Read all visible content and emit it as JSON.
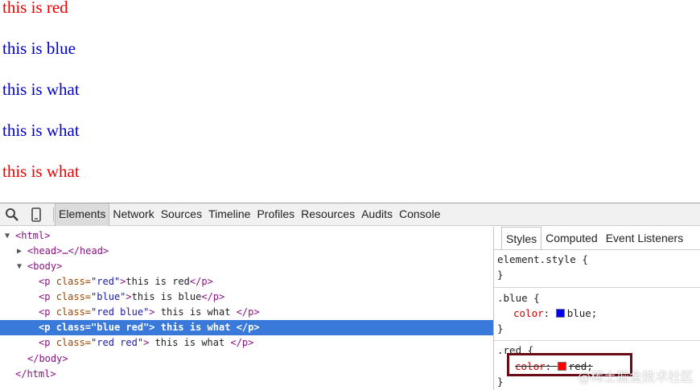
{
  "page": {
    "lines": [
      {
        "text": "this is red",
        "color": "#ee0000"
      },
      {
        "text": "this is blue",
        "color": "#0000cc"
      },
      {
        "text": "this is what",
        "color": "#0000cc"
      },
      {
        "text": "this is what",
        "color": "#0000cc"
      },
      {
        "text": "this is what",
        "color": "#ee0000"
      }
    ]
  },
  "toolbar": {
    "tabs": [
      "Elements",
      "Network",
      "Sources",
      "Timeline",
      "Profiles",
      "Resources",
      "Audits",
      "Console"
    ],
    "active_tab": "Elements",
    "icons": [
      "search-icon",
      "device-mode-icon"
    ]
  },
  "dom": {
    "html_open": "<html>",
    "head": "<head>…</head>",
    "body_open": "<body>",
    "p1": {
      "tag_open": "<p ",
      "attr": "class=",
      "val": "\"red\"",
      "close": ">",
      "text": "this is red",
      "end": "</p>"
    },
    "p2": {
      "tag_open": "<p ",
      "attr": "class=",
      "val": "\"blue\"",
      "close": ">",
      "text": "this is blue",
      "end": "</p>"
    },
    "p3": {
      "tag_open": "<p ",
      "attr": "class=",
      "val": "\"red blue\"",
      "close": ">",
      "text": " this is what ",
      "end": "</p>"
    },
    "p4": {
      "tag_open": "<p ",
      "attr": "class=",
      "val": "\"blue red\"",
      "close": ">",
      "text": " this is what ",
      "end": "</p>"
    },
    "p5": {
      "tag_open": "<p ",
      "attr": "class=",
      "val": "\"red red\"",
      "close": ">",
      "text": " this is what ",
      "end": "</p>"
    },
    "body_close": "</body>",
    "html_close": "</html>"
  },
  "styles": {
    "tabs": [
      "Styles",
      "Computed",
      "Event Listeners"
    ],
    "active_tab": "Styles",
    "element_style_selector": "element.style {",
    "close_brace": "}",
    "blue_rule": {
      "selector": ".blue {",
      "property": "color",
      "colon": ":",
      "value": "blue;",
      "swatch": "#0000ee"
    },
    "red_rule": {
      "selector": ".red {",
      "property": "color",
      "colon": ":",
      "value": "red;",
      "swatch": "#ff0000"
    }
  },
  "watermark": "@稀土掘金技术社区",
  "colors": {
    "selection": "#3879d9",
    "tag": "#881280",
    "attr": "#994500",
    "value": "#1a1aa6",
    "highlight_box": "#6b0b16"
  }
}
